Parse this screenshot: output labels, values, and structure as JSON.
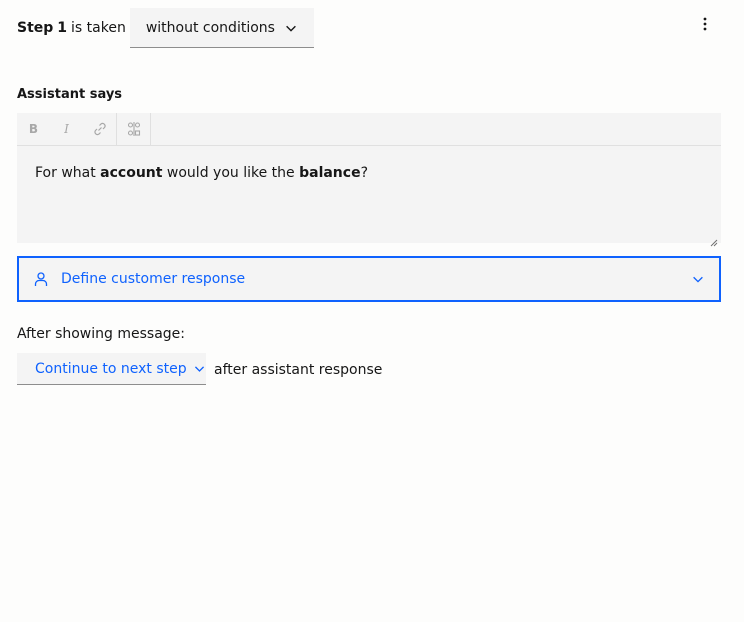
{
  "step_header": {
    "step_label": "Step",
    "step_number": "1",
    "is_taken_text": "is taken",
    "condition_value": "without conditions",
    "overflow_icon": "overflow-menu-vertical-icon"
  },
  "assistant_says": {
    "label": "Assistant says",
    "toolbar": {
      "bold_glyph": "B",
      "italic_glyph": "I",
      "link_icon": "link-icon",
      "variable_icon": "variable-icon"
    },
    "message": {
      "part1": "For what ",
      "bold1": "account",
      "part2": " would you like the ",
      "bold2": "balance",
      "part3": "?"
    }
  },
  "customer_response": {
    "label": "Define customer response",
    "icon": "user-icon"
  },
  "after_message": {
    "label": "After showing message:",
    "action_value": "Continue to next step",
    "suffix": "after assistant response"
  },
  "colors": {
    "accent": "#0f62fe",
    "field_bg": "#f4f4f4",
    "text": "#161616",
    "disabled_icon": "#a8a8a8"
  }
}
